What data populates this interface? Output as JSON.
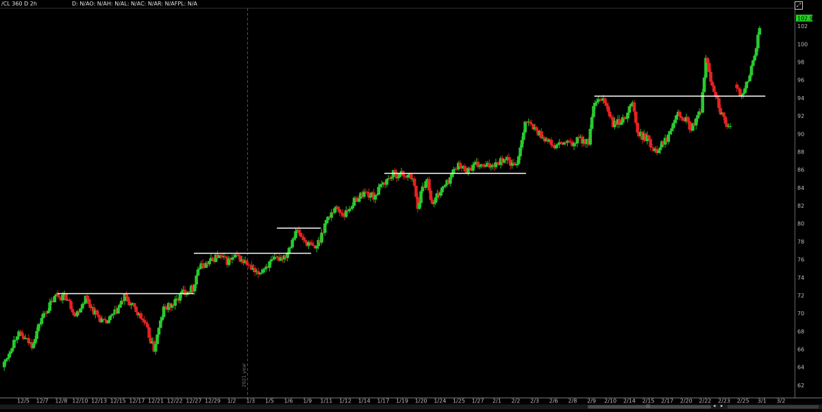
{
  "header": {
    "symbol": "/CL 360 D 2h",
    "stats": "D: N/AO: N/AH: N/AL: N/AC: N/AR: N/AFPL: N/A"
  },
  "colors": {
    "background": "#000000",
    "up": "#29c92f",
    "down": "#e52222",
    "level_line": "#ffffff",
    "last_price_bg": "#1fd81f",
    "divider": "#666666"
  },
  "chart_data": {
    "type": "candlestick",
    "ylim": [
      61,
      104
    ],
    "yticks": [
      62,
      64,
      66,
      68,
      70,
      72,
      74,
      76,
      78,
      80,
      82,
      84,
      86,
      88,
      90,
      92,
      94,
      96,
      98,
      100,
      102
    ],
    "x_labels": [
      "12/5",
      "12/7",
      "12/8",
      "12/10",
      "12/13",
      "12/15",
      "12/17",
      "12/21",
      "12/22",
      "12/27",
      "12/29",
      "1/2",
      "1/3",
      "1/5",
      "1/6",
      "1/9",
      "1/11",
      "1/12",
      "1/14",
      "1/17",
      "1/19",
      "1/20",
      "1/24",
      "1/25",
      "1/27",
      "2/1",
      "2/2",
      "2/3",
      "2/6",
      "2/8",
      "2/9",
      "2/10",
      "2/14",
      "2/15",
      "2/17",
      "2/20",
      "2/22",
      "2/23",
      "2/25",
      "3/1",
      "3/2"
    ],
    "last_price": "102.9",
    "year_marker": "2021 year",
    "price_path": [
      [
        0,
        64.0
      ],
      [
        3,
        67.8
      ],
      [
        6,
        66.5
      ],
      [
        8,
        69.5
      ],
      [
        11,
        72.0
      ],
      [
        13,
        71.8
      ],
      [
        15,
        69.8
      ],
      [
        17,
        71.8
      ],
      [
        19,
        70.0
      ],
      [
        21,
        68.8
      ],
      [
        23,
        70.0
      ],
      [
        25,
        71.8
      ],
      [
        27,
        70.5
      ],
      [
        29,
        69.0
      ],
      [
        31,
        66.0
      ],
      [
        33,
        70.5
      ],
      [
        35,
        71.0
      ],
      [
        37,
        72.4
      ],
      [
        39,
        72.8
      ],
      [
        40,
        75.0
      ],
      [
        42,
        75.6
      ],
      [
        44,
        76.4
      ],
      [
        46,
        75.8
      ],
      [
        48,
        76.3
      ],
      [
        50,
        75.5
      ],
      [
        52,
        74.3
      ],
      [
        54,
        75.3
      ],
      [
        56,
        76.0
      ],
      [
        58,
        76.5
      ],
      [
        59,
        77.8
      ],
      [
        60,
        79.3
      ],
      [
        62,
        78.0
      ],
      [
        64,
        77.2
      ],
      [
        65,
        78.3
      ],
      [
        66,
        80.0
      ],
      [
        68,
        81.8
      ],
      [
        70,
        81.0
      ],
      [
        72,
        82.5
      ],
      [
        74,
        83.5
      ],
      [
        76,
        83.0
      ],
      [
        78,
        84.5
      ],
      [
        80,
        85.5
      ],
      [
        82,
        85.5
      ],
      [
        84,
        85.0
      ],
      [
        85,
        82.0
      ],
      [
        86,
        84.0
      ],
      [
        87,
        85.0
      ],
      [
        88,
        82.0
      ],
      [
        89,
        83.2
      ],
      [
        91,
        84.5
      ],
      [
        93,
        86.5
      ],
      [
        95,
        86.0
      ],
      [
        97,
        86.5
      ],
      [
        99,
        86.3
      ],
      [
        101,
        86.8
      ],
      [
        103,
        87.3
      ],
      [
        105,
        86.2
      ],
      [
        106,
        88.5
      ],
      [
        107,
        91.5
      ],
      [
        109,
        90.5
      ],
      [
        111,
        89.5
      ],
      [
        113,
        88.5
      ],
      [
        115,
        89.0
      ],
      [
        117,
        88.8
      ],
      [
        118,
        89.5
      ],
      [
        120,
        89.0
      ],
      [
        121,
        93.0
      ],
      [
        123,
        94.0
      ],
      [
        125,
        91.0
      ],
      [
        127,
        91.5
      ],
      [
        129,
        93.5
      ],
      [
        130,
        90.0
      ],
      [
        132,
        89.5
      ],
      [
        133,
        88.5
      ],
      [
        134,
        88.3
      ],
      [
        136,
        89.5
      ],
      [
        138,
        92.5
      ],
      [
        140,
        91.5
      ],
      [
        141,
        90.5
      ],
      [
        142,
        91.5
      ],
      [
        143,
        92.5
      ],
      [
        144,
        98.5
      ],
      [
        145,
        96.0
      ],
      [
        146,
        94.5
      ],
      [
        147,
        92.5
      ],
      [
        148,
        91.0
      ],
      [
        149,
        90.5
      ],
      [
        150,
        95.5
      ],
      [
        151,
        94.5
      ],
      [
        152,
        95.0
      ],
      [
        153,
        96.5
      ],
      [
        154,
        99.0
      ],
      [
        155,
        101.5
      ]
    ],
    "gaps": [
      149
    ],
    "levels": [
      {
        "price": 72.2,
        "from": 11,
        "to": 39
      },
      {
        "price": 76.7,
        "from": 39,
        "to": 63
      },
      {
        "price": 79.5,
        "from": 56,
        "to": 65
      },
      {
        "price": 85.6,
        "from": 78,
        "to": 107
      },
      {
        "price": 94.2,
        "from": 121,
        "to": 156
      }
    ]
  }
}
